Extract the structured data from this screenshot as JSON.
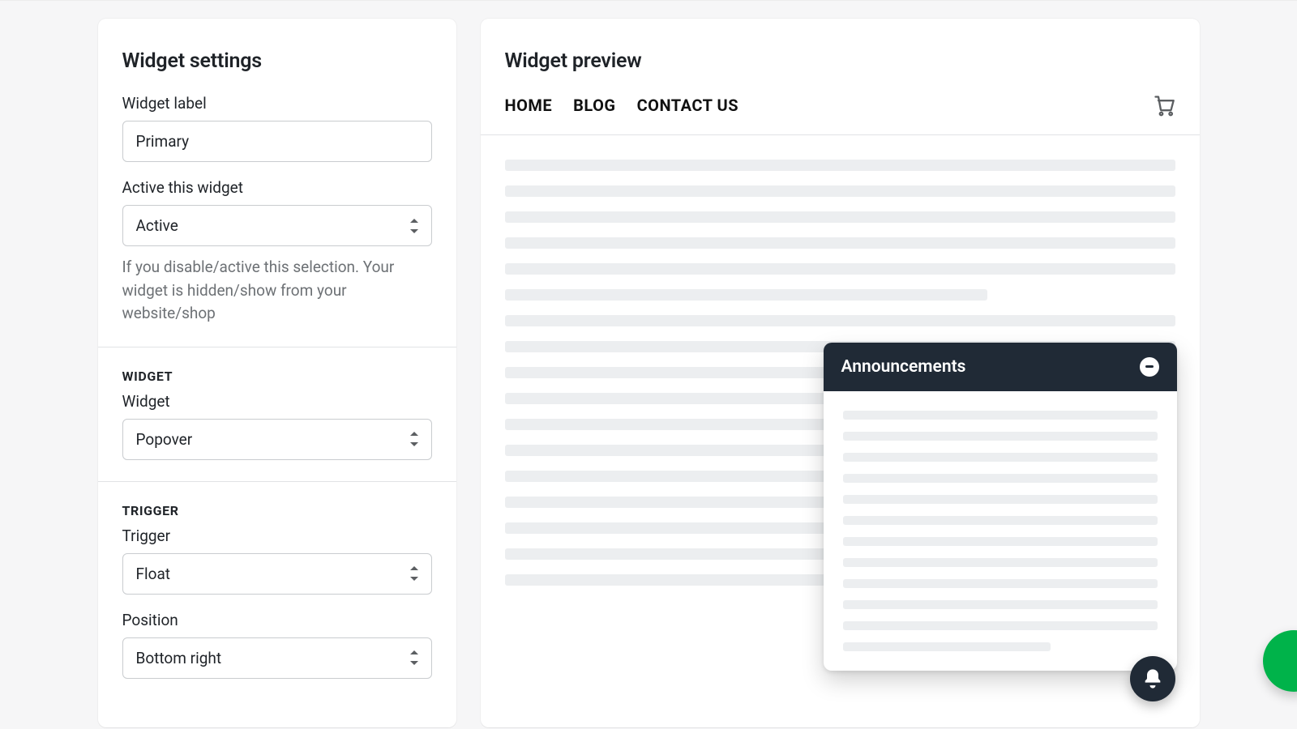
{
  "settings": {
    "title": "Widget settings",
    "widget_label_field": {
      "label": "Widget label",
      "value": "Primary"
    },
    "active_field": {
      "label": "Active this widget",
      "value": "Active",
      "help": "If you disable/active this selection. Your widget is hidden/show from your website/shop"
    },
    "widget_section": {
      "header": "WIDGET",
      "type_label": "Widget",
      "type_value": "Popover"
    },
    "trigger_section": {
      "header": "TRIGGER",
      "trigger_label": "Trigger",
      "trigger_value": "Float",
      "position_label": "Position",
      "position_value": "Bottom right"
    }
  },
  "preview": {
    "title": "Widget preview",
    "nav": {
      "home": "HOME",
      "blog": "BLOG",
      "contact": "CONTACT US"
    },
    "popover_title": "Announcements"
  }
}
